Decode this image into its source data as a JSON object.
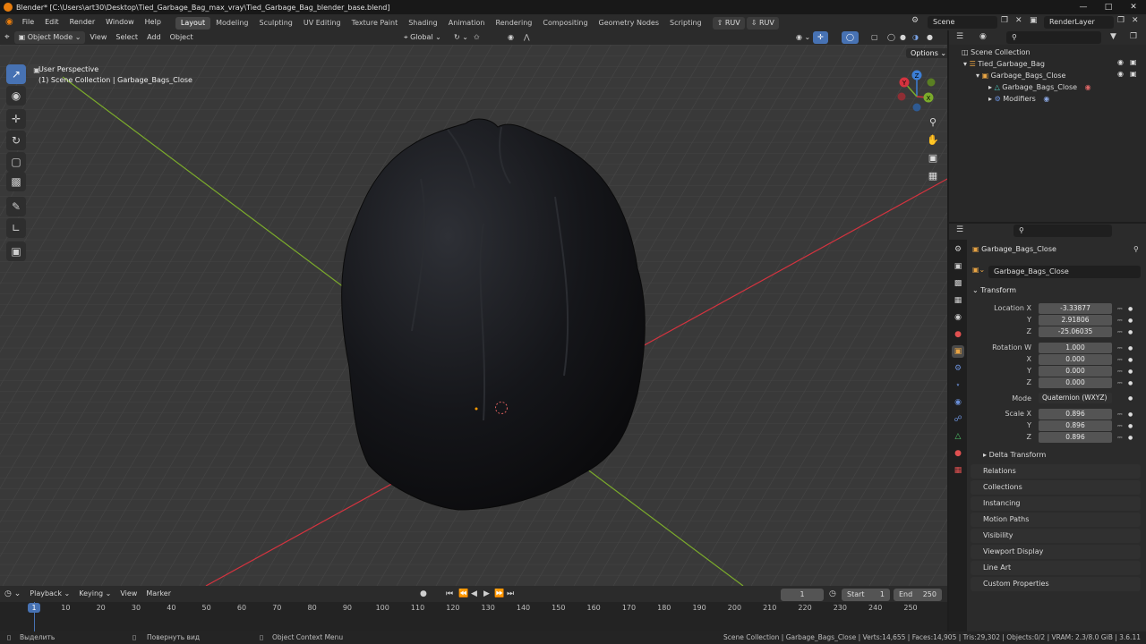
{
  "title_bar": {
    "text": "Blender* [C:\\Users\\art30\\Desktop\\Tied_Garbage_Bag_max_vray\\Tied_Garbage_Bag_blender_base.blend]"
  },
  "menu": [
    "File",
    "Edit",
    "Render",
    "Window",
    "Help"
  ],
  "workspaces": [
    "Layout",
    "Modeling",
    "Sculpting",
    "UV Editing",
    "Texture Paint",
    "Shading",
    "Animation",
    "Rendering",
    "Compositing",
    "Geometry Nodes",
    "Scripting"
  ],
  "active_workspace": "Layout",
  "ruv_buttons": [
    "RUV",
    "RUV"
  ],
  "scene": "Scene",
  "render_layer": "RenderLayer",
  "viewport_header": {
    "mode": "Object Mode",
    "menus": [
      "View",
      "Select",
      "Add",
      "Object"
    ],
    "orientation": "Global",
    "options": "Options"
  },
  "viewport": {
    "perspective": "User Perspective",
    "collection_info": "(1) Scene Collection | Garbage_Bags_Close",
    "axes": {
      "x": "X",
      "y": "Y",
      "z": "Z"
    }
  },
  "outliner": {
    "root": "Scene Collection",
    "items": [
      {
        "label": "Tied_Garbage_Bag",
        "depth": 1
      },
      {
        "label": "Garbage_Bags_Close",
        "depth": 2
      },
      {
        "label": "Garbage_Bags_Close",
        "depth": 3
      },
      {
        "label": "Modifiers",
        "depth": 3
      }
    ]
  },
  "properties": {
    "object_name": "Garbage_Bags_Close",
    "name_field": "Garbage_Bags_Close",
    "transform_label": "Transform",
    "location": {
      "label_x": "Location X",
      "label_y": "Y",
      "label_z": "Z",
      "x": "-3.33877",
      "y": "2.91806",
      "z": "-25.06035"
    },
    "rotation": {
      "label_w": "Rotation W",
      "label_x": "X",
      "label_y": "Y",
      "label_z": "Z",
      "w": "1.000",
      "x": "0.000",
      "y": "0.000",
      "z": "0.000"
    },
    "mode_label": "Mode",
    "mode": "Quaternion (WXYZ)",
    "scale": {
      "label_x": "Scale X",
      "label_y": "Y",
      "label_z": "Z",
      "x": "0.896",
      "y": "0.896",
      "z": "0.896"
    },
    "delta_transform": "Delta Transform",
    "panels": [
      "Relations",
      "Collections",
      "Instancing",
      "Motion Paths",
      "Visibility",
      "Viewport Display",
      "Line Art",
      "Custom Properties"
    ]
  },
  "timeline": {
    "menus": [
      "Playback",
      "Keying",
      "View",
      "Marker"
    ],
    "current_frame": "1",
    "start_label": "Start",
    "start": "1",
    "end_label": "End",
    "end": "250",
    "ruler": [
      "1",
      "10",
      "20",
      "30",
      "40",
      "50",
      "60",
      "70",
      "80",
      "90",
      "100",
      "110",
      "120",
      "130",
      "140",
      "150",
      "160",
      "170",
      "180",
      "190",
      "200",
      "210",
      "220",
      "230",
      "240",
      "250"
    ]
  },
  "status_bar": {
    "select": "Выделить",
    "rotate": "Повернуть вид",
    "context": "Object Context Menu",
    "stats": "Scene Collection | Garbage_Bags_Close | Verts:14,655 | Faces:14,905 | Tris:29,302 | Objects:0/2 | VRAM: 2.3/8.0 GiB | 3.6.11"
  },
  "colors": {
    "accent": "#4772b3",
    "axis_x": "#d4333f",
    "axis_y": "#7bab2b",
    "axis_z": "#3c7ed6"
  }
}
